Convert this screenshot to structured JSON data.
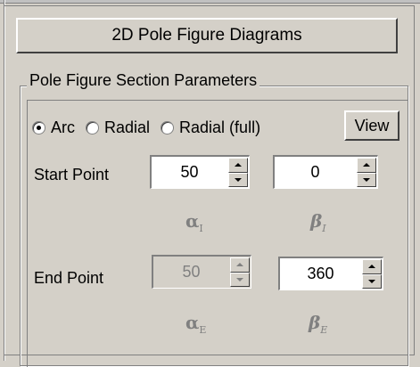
{
  "title": "2D Pole Figure Diagrams",
  "group_title": "Pole Figure Section Parameters",
  "mode": {
    "options": [
      {
        "label": "Arc",
        "selected": true
      },
      {
        "label": "Radial",
        "selected": false
      },
      {
        "label": "Radial (full)",
        "selected": false
      }
    ],
    "view_label": "View"
  },
  "start_point": {
    "label": "Start Point",
    "alpha": {
      "value": "50",
      "enabled": true,
      "symbol": "α",
      "sub": "I"
    },
    "beta": {
      "value": "0",
      "enabled": true,
      "symbol": "β",
      "sub": "I"
    }
  },
  "end_point": {
    "label": "End Point",
    "alpha": {
      "value": "50",
      "enabled": false,
      "symbol": "α",
      "sub": "E"
    },
    "beta": {
      "value": "360",
      "enabled": true,
      "symbol": "β",
      "sub": "E"
    }
  },
  "colors": {
    "face": "#d4d0c8",
    "shadow": "#808080",
    "highlight": "#ffffff"
  }
}
